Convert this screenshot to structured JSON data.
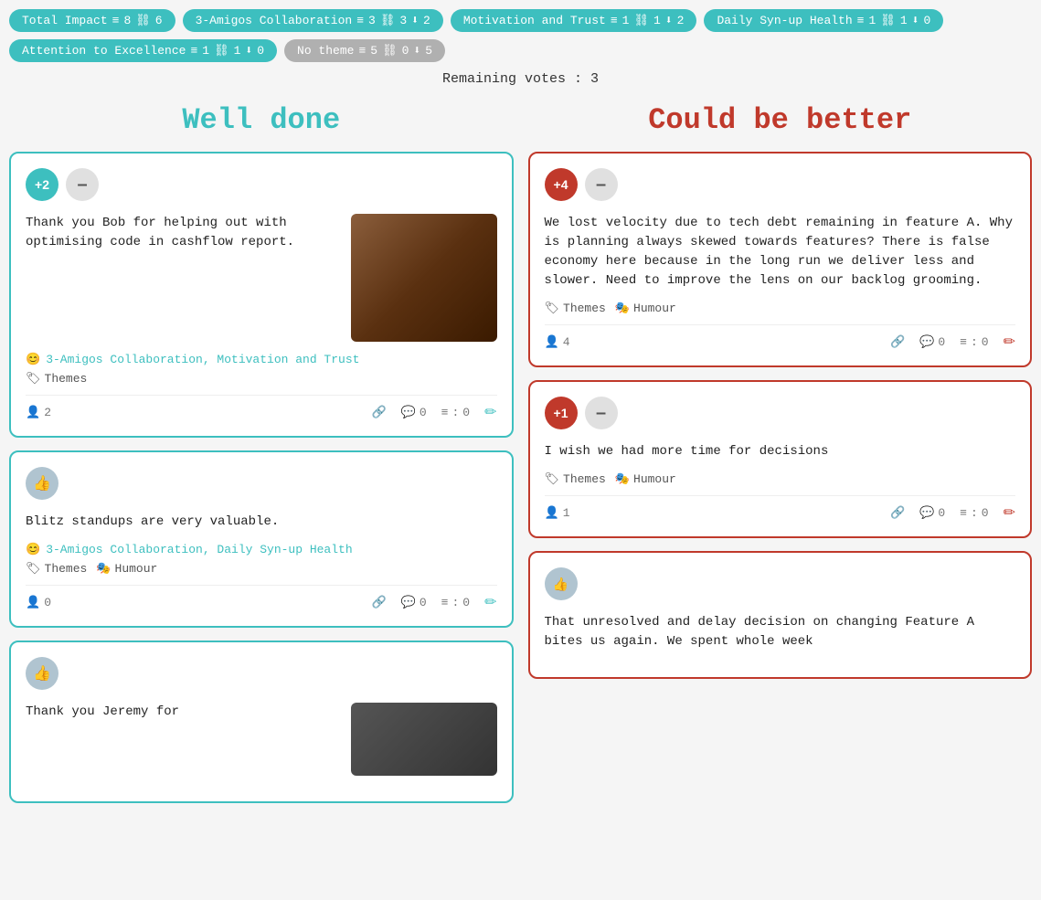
{
  "tags": [
    {
      "id": "total-impact",
      "label": "Total Impact",
      "layers": "8",
      "chain": "6",
      "down": null,
      "style": "teal"
    },
    {
      "id": "3-amigos",
      "label": "3-Amigos Collaboration",
      "layers": "3",
      "chain": "3",
      "down": "2",
      "style": "teal"
    },
    {
      "id": "motivation",
      "label": "Motivation and Trust",
      "layers": "1",
      "chain": "1",
      "down": "2",
      "style": "teal"
    },
    {
      "id": "daily-sync",
      "label": "Daily Syn-up Health",
      "layers": "1",
      "chain": "1",
      "down": "0",
      "style": "teal"
    },
    {
      "id": "attention",
      "label": "Attention to Excellence",
      "layers": "1",
      "chain": "1",
      "down": "0",
      "style": "teal"
    },
    {
      "id": "no-theme",
      "label": "No theme",
      "layers": "5",
      "chain": "0",
      "down": "5",
      "style": "grey"
    }
  ],
  "remaining": "Remaining votes : 3",
  "columns": {
    "well": {
      "title": "Well done",
      "cards": [
        {
          "id": "card-well-1",
          "vote": "+2",
          "hasImage": true,
          "imageStyle": "brown",
          "text": "Thank you Bob for helping out with optimising code in cashflow report.",
          "themes": "3-Amigos Collaboration, Motivation and Trust",
          "hasTags": false,
          "tags": [
            "Themes"
          ],
          "footerPerson": "2",
          "footerComment": "0",
          "footerList": "0"
        },
        {
          "id": "card-well-2",
          "vote": "thumb",
          "hasImage": false,
          "text": "Blitz standups are very valuable.",
          "themes": "3-Amigos Collaboration, Daily Syn-up Health",
          "hasTags": true,
          "tags": [
            "Themes",
            "Humour"
          ],
          "footerPerson": "0",
          "footerComment": "0",
          "footerList": "0"
        },
        {
          "id": "card-well-3",
          "vote": "thumb",
          "hasImage": true,
          "imageStyle": "dark",
          "text": "Thank you Jeremy for",
          "themes": "",
          "hasTags": false,
          "tags": [],
          "footerPerson": "",
          "footerComment": "",
          "footerList": ""
        }
      ]
    },
    "better": {
      "title": "Could be better",
      "cards": [
        {
          "id": "card-better-1",
          "vote": "+4",
          "text": "We lost velocity due to tech debt remaining in feature A. Why is planning always skewed towards features? There is false economy here because in the long run we deliver less and slower. Need to improve the lens on our backlog grooming.",
          "themes": "",
          "hasTags": true,
          "tags": [
            "Themes",
            "Humour"
          ],
          "footerPerson": "4",
          "footerComment": "0",
          "footerList": "0"
        },
        {
          "id": "card-better-2",
          "vote": "+1",
          "text": "I wish we had more time for decisions",
          "themes": "",
          "hasTags": true,
          "tags": [
            "Themes",
            "Humour"
          ],
          "footerPerson": "1",
          "footerComment": "0",
          "footerList": "0"
        },
        {
          "id": "card-better-3",
          "vote": "thumb-grey",
          "text": "That unresolved and delay decision on changing Feature A bites us again. We spent whole week",
          "themes": "",
          "hasTags": false,
          "tags": [],
          "footerPerson": "",
          "footerComment": "",
          "footerList": ""
        }
      ]
    }
  },
  "icons": {
    "layers": "≡",
    "chain": "⛓",
    "down": "⬇",
    "tag": "🏷",
    "mask": "🎭",
    "person": "👤",
    "link": "🔗",
    "comment": "💬",
    "list": "≡",
    "edit": "✏",
    "thumb": "👍",
    "smiley": "😊"
  }
}
